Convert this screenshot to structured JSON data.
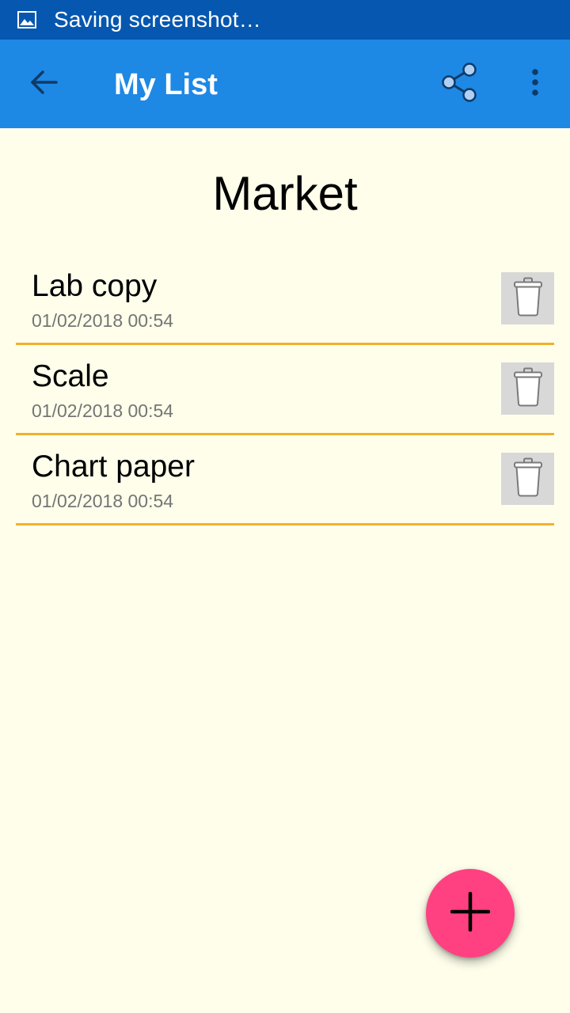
{
  "status_bar": {
    "icon": "image-icon",
    "text": "Saving screenshot…",
    "background": "#0657AF"
  },
  "app_bar": {
    "title": "My List",
    "back_icon": "arrow-left-icon",
    "share_icon": "share-icon",
    "more_icon": "more-vertical-icon",
    "background": "#1E88E5"
  },
  "list": {
    "title": "Market",
    "items": [
      {
        "name": "Lab copy",
        "date": "01/02/2018 00:54"
      },
      {
        "name": "Scale",
        "date": "01/02/2018 00:54"
      },
      {
        "name": "Chart paper",
        "date": "01/02/2018 00:54"
      }
    ],
    "divider_color": "#F2B12A",
    "delete_icon": "trash-icon"
  },
  "fab": {
    "icon": "plus-icon",
    "color": "#FF4081"
  },
  "page_background": "#FEFEEB"
}
